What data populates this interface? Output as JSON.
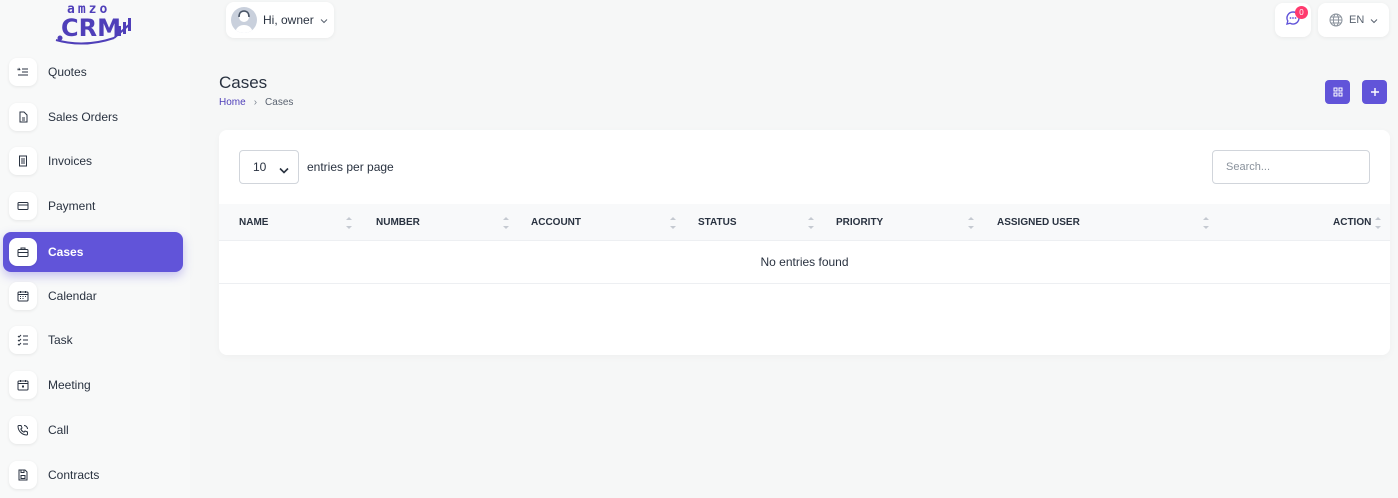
{
  "brand": {
    "logo_top": "amzo",
    "logo_main": "CRM",
    "accent": "#6154d9"
  },
  "sidebar": {
    "items": [
      {
        "label": "Quotes",
        "icon": "quotes-icon"
      },
      {
        "label": "Sales Orders",
        "icon": "file-icon"
      },
      {
        "label": "Invoices",
        "icon": "receipt-icon"
      },
      {
        "label": "Payment",
        "icon": "credit-card-icon"
      },
      {
        "label": "Cases",
        "icon": "briefcase-icon",
        "active": true
      },
      {
        "label": "Calendar",
        "icon": "calendar-icon"
      },
      {
        "label": "Task",
        "icon": "checklist-icon"
      },
      {
        "label": "Meeting",
        "icon": "calendar-event-icon"
      },
      {
        "label": "Call",
        "icon": "phone-icon"
      },
      {
        "label": "Contracts",
        "icon": "save-file-icon"
      }
    ]
  },
  "header": {
    "greeting": "Hi, owner",
    "notification_count": "0",
    "language": "EN"
  },
  "page": {
    "title": "Cases",
    "breadcrumb": {
      "home": "Home",
      "separator": "›",
      "current": "Cases"
    }
  },
  "table": {
    "per_page_value": "10",
    "per_page_label": "entries per page",
    "search_placeholder": "Search...",
    "columns": [
      "NAME",
      "NUMBER",
      "ACCOUNT",
      "STATUS",
      "PRIORITY",
      "ASSIGNED USER",
      "ACTION"
    ],
    "empty_message": "No entries found"
  }
}
